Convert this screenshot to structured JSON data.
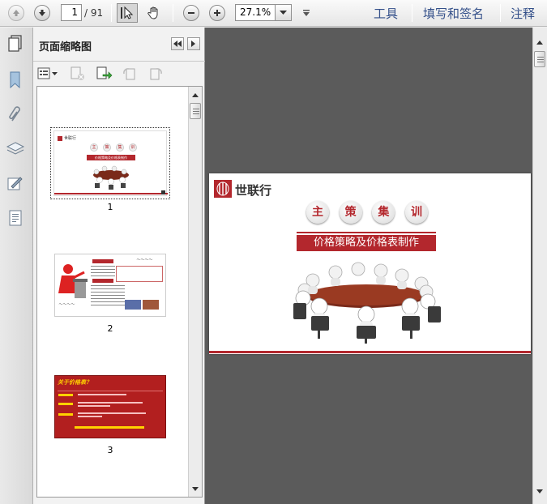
{
  "toolbar": {
    "page_current": "1",
    "page_total": "/ 91",
    "zoom_value": "27.1%",
    "menu_tools": "工具",
    "menu_fill_sign": "填写和签名",
    "menu_comment": "注释"
  },
  "sidebar": {
    "title": "页面缩略图"
  },
  "thumbnails": [
    {
      "label": "1"
    },
    {
      "label": "2"
    },
    {
      "label": "3"
    }
  ],
  "thumb1": {
    "logo": "世联行",
    "words": [
      "主",
      "策",
      "集",
      "训"
    ],
    "subtitle": "价格策略及价格表制作"
  },
  "thumb3": {
    "heading": "关于价格表？"
  },
  "slide": {
    "logo_text": "世联行",
    "title_chars": [
      "主",
      "策",
      "集",
      "训"
    ],
    "subtitle": "价格策略及价格表制作"
  },
  "colors": {
    "brand_red": "#b3272d",
    "link_blue": "#34508a",
    "table_brown": "#7a2a1a"
  },
  "icons": [
    "prev-page-icon",
    "next-page-icon",
    "select-tool-icon",
    "hand-tool-icon",
    "zoom-out-icon",
    "zoom-in-icon",
    "bookmark-icon",
    "attachment-icon",
    "layers-icon",
    "signature-icon",
    "page-content-icon"
  ]
}
